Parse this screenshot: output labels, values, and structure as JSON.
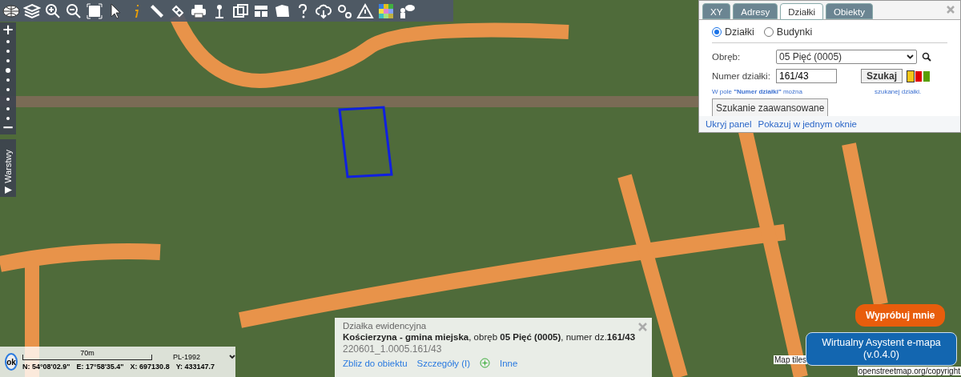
{
  "zoom_control": {
    "zoom_in": "+",
    "zoom_out": "−",
    "level": 0.625
  },
  "layers_tab": {
    "label": "Warstwy"
  },
  "search_panel": {
    "tabs": [
      {
        "label": "XY",
        "selected": false
      },
      {
        "label": "Adresy",
        "selected": false
      },
      {
        "label": "Działki",
        "selected": true
      },
      {
        "label": "Obiekty",
        "selected": false
      }
    ],
    "modes": [
      {
        "label": "Działki",
        "selected": true
      },
      {
        "label": "Budynki",
        "selected": false
      }
    ],
    "district_label": "Obręb:",
    "district_value": "05 Pięć (0005)",
    "number_label": "Numer działki:",
    "number_value": "161/43",
    "search_button": "Szukaj",
    "swatches": [
      {
        "color": "#f5c518",
        "selected": true
      },
      {
        "color": "#e00000",
        "selected": false
      },
      {
        "color": "#5a9e00",
        "selected": false
      }
    ],
    "hint_start": "W pole **\"Numer działki\"** można",
    "hint_end": "szukanej działki.",
    "advanced_button": "Szukanie zaawansowane",
    "links": [
      "Ukryj panel",
      "Pokazuj w jednym oknie"
    ]
  },
  "info_panel": {
    "title": "Działka ewidencyjna",
    "description": "**Kościerzyna - gmina miejska**, obręb **05 Pięć (0005)**, numer dz.**161/43**",
    "identifier": "220601_1.0005.161/43",
    "links": [
      "Zbliz do obiektu",
      "Szczegóły (I)",
      "Inne"
    ]
  },
  "coordinates": {
    "ok": "ok",
    "scale": "70m",
    "crs": "PL-1992",
    "n": "N: 54°08'02.9\"",
    "e": "E: 17°58'35.4\"",
    "x": "X: 697130.8",
    "y": "Y: 433147.7"
  },
  "assistant": {
    "try_label": "Wypróbuj mnie",
    "button": "Wirtualny Asystent e-mapa (v.0.4.0)"
  },
  "attribution": [
    "Map tiles",
    "openstreetmap.org/copyright"
  ]
}
